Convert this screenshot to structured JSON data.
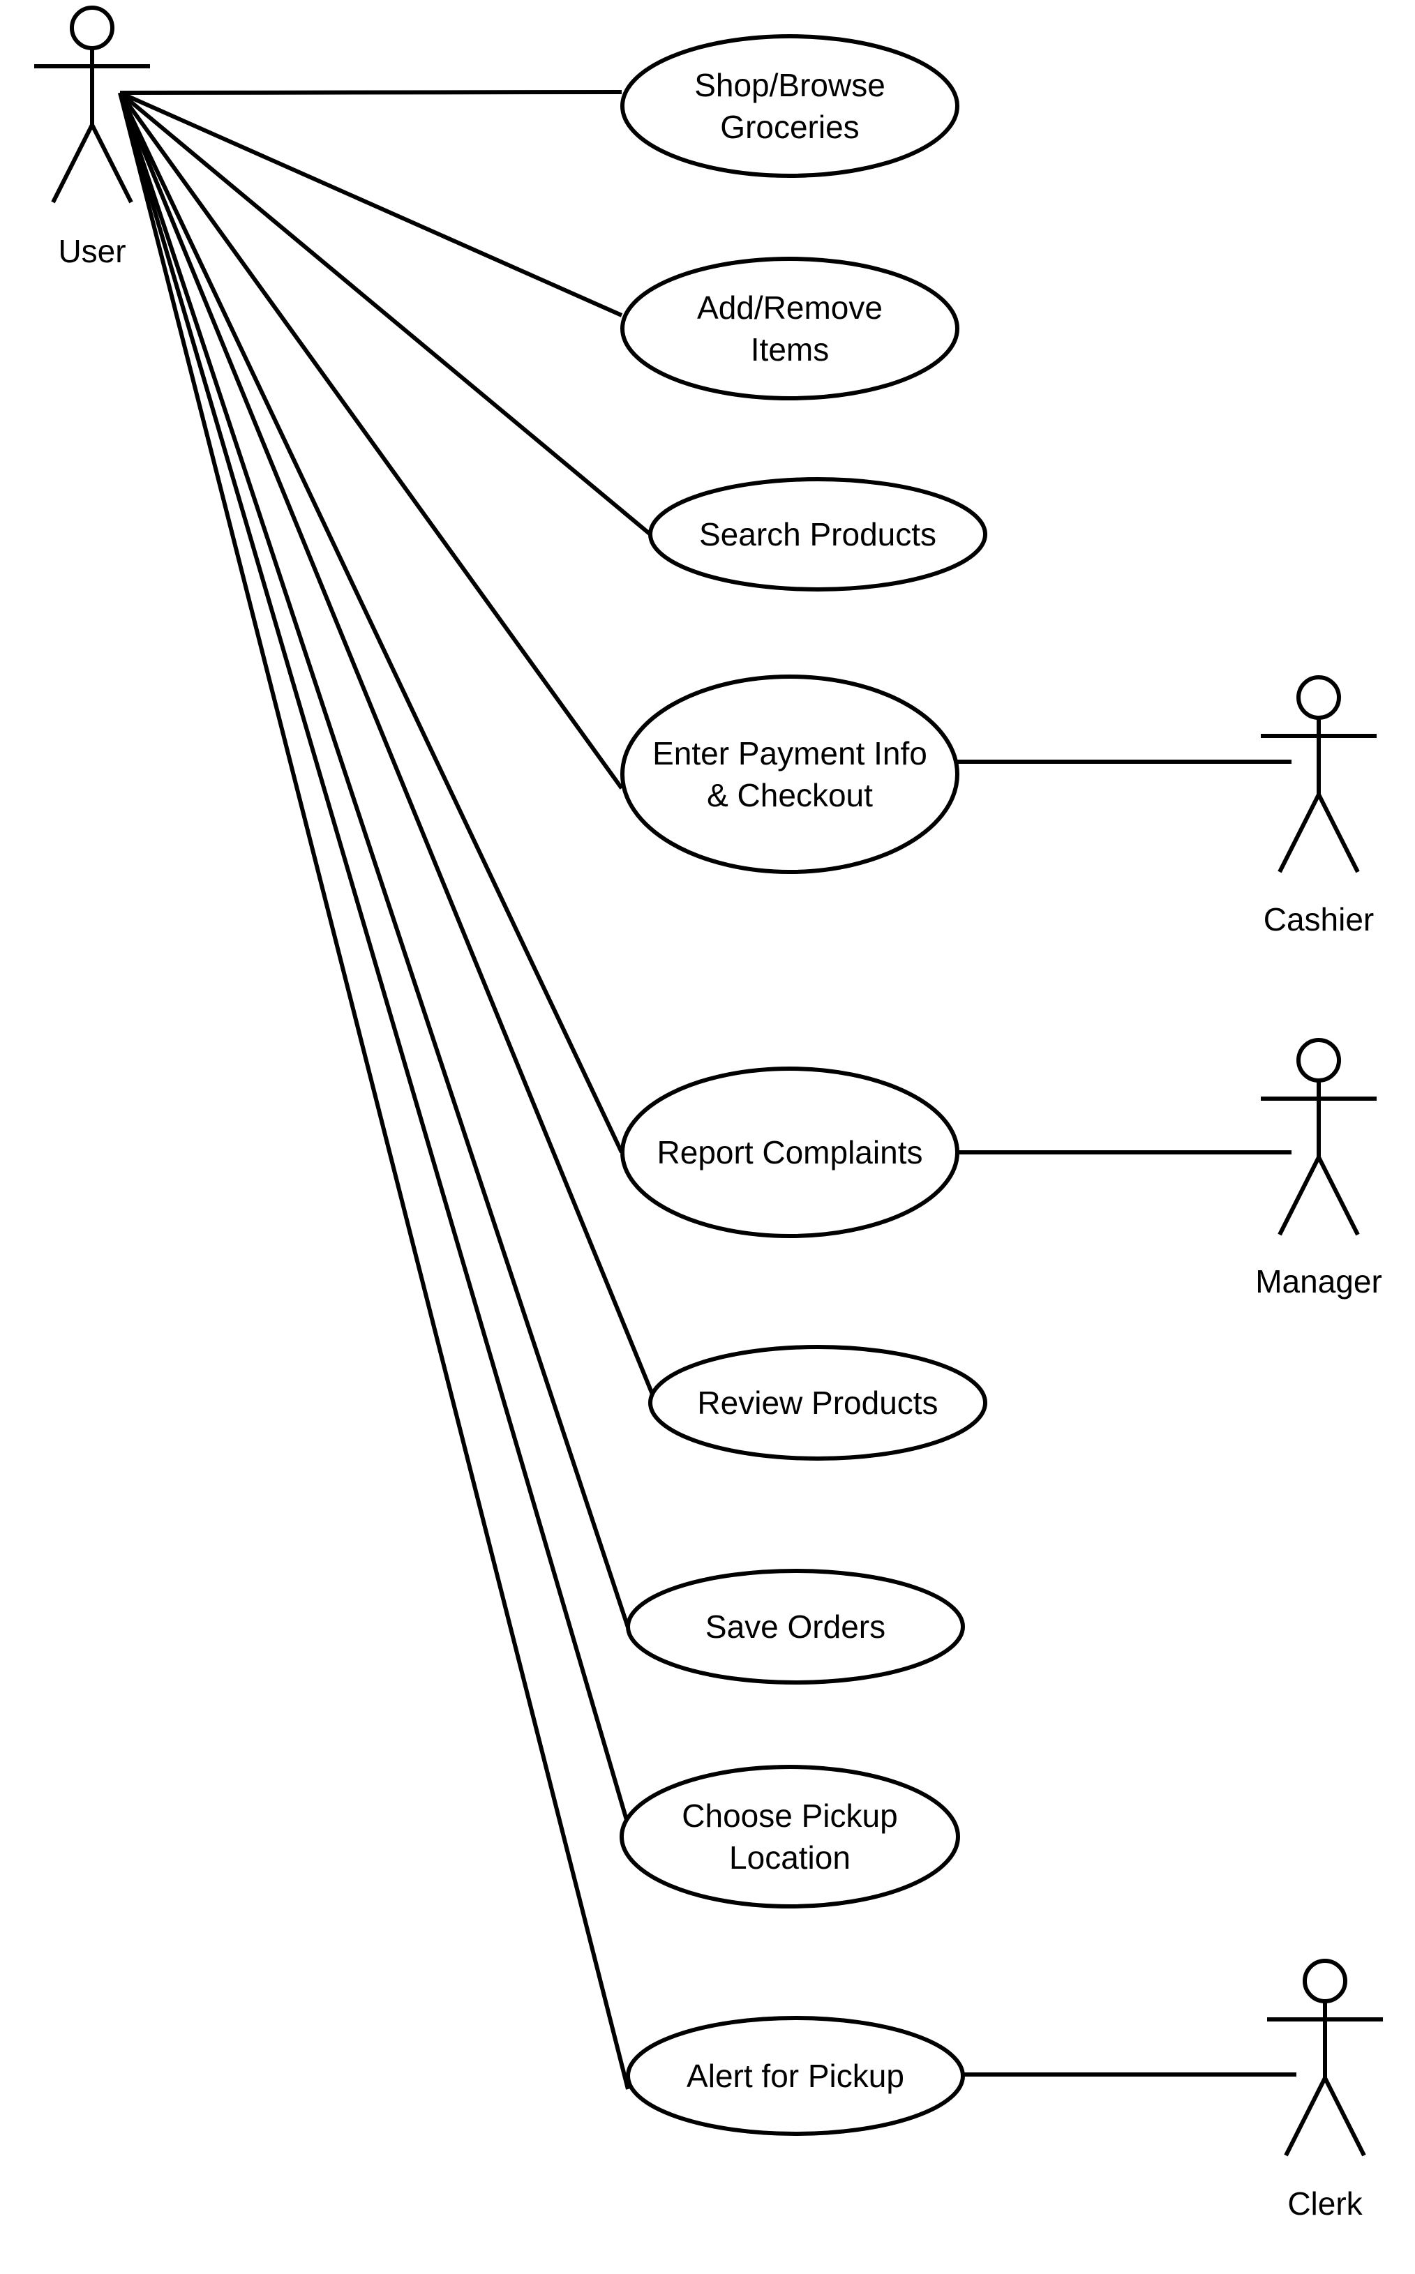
{
  "diagram": {
    "type": "UML use case diagram",
    "colors": {
      "line": "#000000",
      "background": "#ffffff"
    },
    "actors": [
      {
        "id": "user",
        "label": "User"
      },
      {
        "id": "cashier",
        "label": "Cashier"
      },
      {
        "id": "manager",
        "label": "Manager"
      },
      {
        "id": "clerk",
        "label": "Clerk"
      }
    ],
    "use_cases": [
      {
        "id": "shop",
        "lines": [
          "Shop/Browse",
          "Groceries"
        ]
      },
      {
        "id": "add-remove",
        "lines": [
          "Add/Remove",
          "Items"
        ]
      },
      {
        "id": "search",
        "lines": [
          "Search Products"
        ]
      },
      {
        "id": "payment",
        "lines": [
          "Enter Payment Info",
          "& Checkout"
        ]
      },
      {
        "id": "report",
        "lines": [
          "Report Complaints"
        ]
      },
      {
        "id": "review",
        "lines": [
          "Review Products"
        ]
      },
      {
        "id": "save",
        "lines": [
          "Save Orders"
        ]
      },
      {
        "id": "pickup-location",
        "lines": [
          "Choose Pickup",
          "Location"
        ]
      },
      {
        "id": "alert",
        "lines": [
          "Alert for Pickup"
        ]
      }
    ],
    "associations": [
      {
        "actor": "user",
        "use_case": "shop"
      },
      {
        "actor": "user",
        "use_case": "add-remove"
      },
      {
        "actor": "user",
        "use_case": "search"
      },
      {
        "actor": "user",
        "use_case": "payment"
      },
      {
        "actor": "user",
        "use_case": "report"
      },
      {
        "actor": "user",
        "use_case": "review"
      },
      {
        "actor": "user",
        "use_case": "save"
      },
      {
        "actor": "user",
        "use_case": "pickup-location"
      },
      {
        "actor": "user",
        "use_case": "alert"
      },
      {
        "actor": "cashier",
        "use_case": "payment"
      },
      {
        "actor": "manager",
        "use_case": "report"
      },
      {
        "actor": "clerk",
        "use_case": "alert"
      }
    ]
  }
}
